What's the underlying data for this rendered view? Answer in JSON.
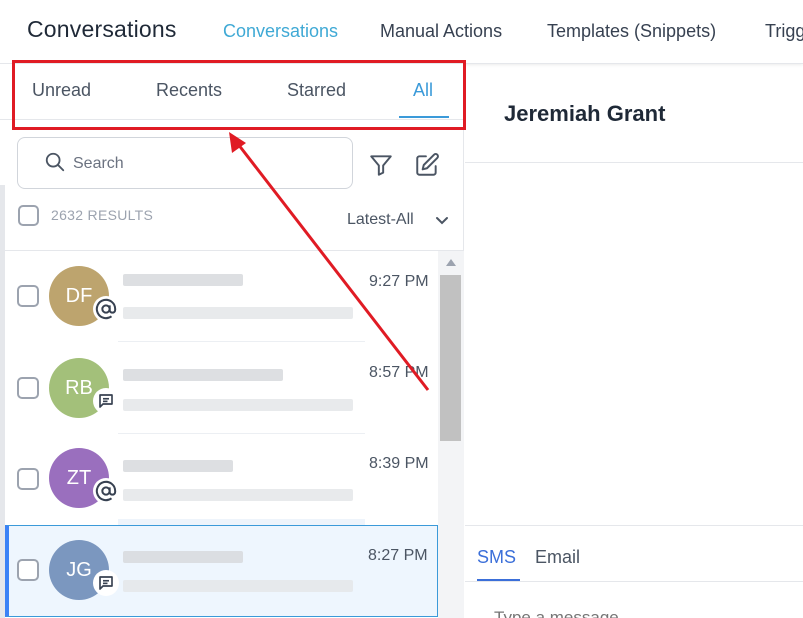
{
  "header": {
    "app_title": "Conversations",
    "nav": [
      {
        "label": "Conversations",
        "active": true
      },
      {
        "label": "Manual Actions",
        "active": false
      },
      {
        "label": "Templates (Snippets)",
        "active": false
      },
      {
        "label": "Trigg",
        "active": false
      }
    ]
  },
  "tabs": [
    {
      "label": "Unread",
      "active": false
    },
    {
      "label": "Recents",
      "active": false
    },
    {
      "label": "Starred",
      "active": false
    },
    {
      "label": "All",
      "active": true
    }
  ],
  "search": {
    "placeholder": "Search",
    "value": ""
  },
  "toolbar": {
    "filter_icon": "filter-icon",
    "compose_icon": "compose-icon"
  },
  "results": {
    "count_label": "2632 RESULTS",
    "sort_label": "Latest-All"
  },
  "conversations": [
    {
      "initials": "DF",
      "avatar_color": "#bda46e",
      "channel_icon": "at-icon",
      "time": "9:27 PM",
      "selected": false
    },
    {
      "initials": "RB",
      "avatar_color": "#a3c07a",
      "channel_icon": "chat-icon",
      "time": "8:57 PM",
      "selected": false
    },
    {
      "initials": "ZT",
      "avatar_color": "#9a6fbe",
      "channel_icon": "at-icon",
      "time": "8:39 PM",
      "selected": false
    },
    {
      "initials": "JG",
      "avatar_color": "#7b97bf",
      "channel_icon": "chat-icon",
      "time": "8:27 PM",
      "selected": true
    }
  ],
  "contact": {
    "name": "Jeremiah Grant"
  },
  "composer": {
    "channels": [
      {
        "label": "SMS",
        "active": true
      },
      {
        "label": "Email",
        "active": false
      }
    ],
    "placeholder": "Type a message"
  },
  "colors": {
    "accent": "#3b9ad9",
    "highlight": "#e01b24",
    "text": "#1f2937"
  }
}
